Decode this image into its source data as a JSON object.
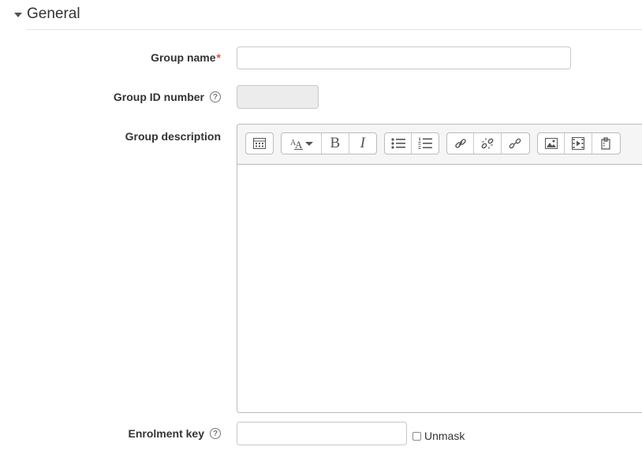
{
  "section": {
    "title": "General"
  },
  "fields": {
    "group_name": {
      "label": "Group name",
      "required_mark": "*",
      "value": ""
    },
    "group_id": {
      "label": "Group ID number",
      "help_glyph": "?",
      "value": ""
    },
    "group_description": {
      "label": "Group description"
    },
    "enrolment_key": {
      "label": "Enrolment key",
      "help_glyph": "?",
      "value": "",
      "unmask_label": "Unmask"
    }
  },
  "toolbar": {
    "icons": [
      "toolbar-toggle-icon",
      "font-size-icon",
      "bold-icon",
      "italic-icon",
      "unordered-list-icon",
      "ordered-list-icon",
      "link-icon",
      "unlink-icon",
      "manage-files-icon",
      "image-icon",
      "media-icon",
      "paste-icon"
    ],
    "bold_glyph": "B",
    "italic_glyph": "I"
  },
  "colors": {
    "required": "#d9534f",
    "disabled_field": "#ececec",
    "toolbar_bg": "#f5f5f5"
  }
}
